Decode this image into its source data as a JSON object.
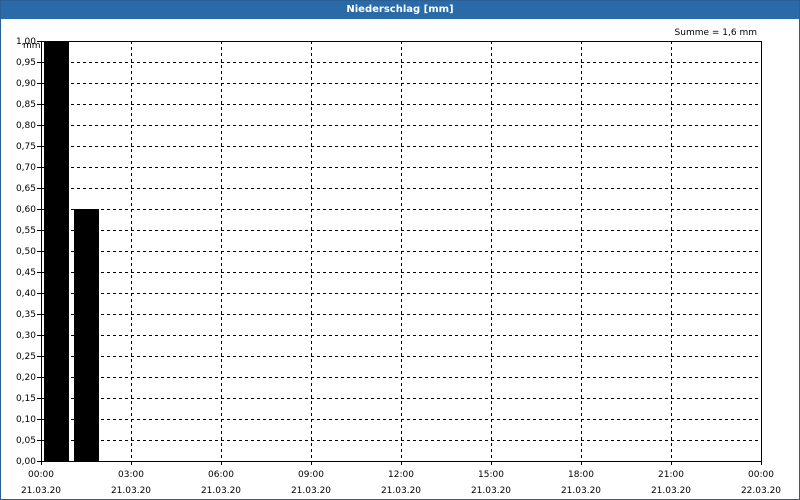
{
  "window": {
    "title": "Niederschlag [mm]"
  },
  "chart_data": {
    "type": "bar",
    "title": "Niederschlag [mm]",
    "ylabel": "mm",
    "ylim": [
      0,
      1.0
    ],
    "yticks": [
      0,
      0.05,
      0.1,
      0.15,
      0.2,
      0.25,
      0.3,
      0.35,
      0.4,
      0.45,
      0.5,
      0.55,
      0.6,
      0.65,
      0.7,
      0.75,
      0.8,
      0.85,
      0.9,
      0.95,
      1.0
    ],
    "ytick_labels": [
      "0,00",
      "0,05",
      "0,10",
      "0,15",
      "0,20",
      "0,25",
      "0,30",
      "0,35",
      "0,40",
      "0,45",
      "0,50",
      "0,55",
      "0,60",
      "0,65",
      "0,70",
      "0,75",
      "0,80",
      "0,85",
      "0,90",
      "0,95",
      "1,00"
    ],
    "xlim_hours": [
      0,
      24
    ],
    "xticks_hours": [
      0,
      3,
      6,
      9,
      12,
      15,
      18,
      21,
      24
    ],
    "xtick_labels": [
      {
        "time": "00:00",
        "date": "21.03.20"
      },
      {
        "time": "03:00",
        "date": "21.03.20"
      },
      {
        "time": "06:00",
        "date": "21.03.20"
      },
      {
        "time": "09:00",
        "date": "21.03.20"
      },
      {
        "time": "12:00",
        "date": "21.03.20"
      },
      {
        "time": "15:00",
        "date": "21.03.20"
      },
      {
        "time": "18:00",
        "date": "21.03.20"
      },
      {
        "time": "21:00",
        "date": "21.03.20"
      },
      {
        "time": "00:00",
        "date": "22.03.20"
      }
    ],
    "bars": [
      {
        "start_hour": 0,
        "end_hour": 1,
        "value": 1.0
      },
      {
        "start_hour": 1,
        "end_hour": 2,
        "value": 0.6
      }
    ],
    "summary": "Summe = 1,6 mm",
    "grid": true,
    "bar_color": "#000000"
  }
}
